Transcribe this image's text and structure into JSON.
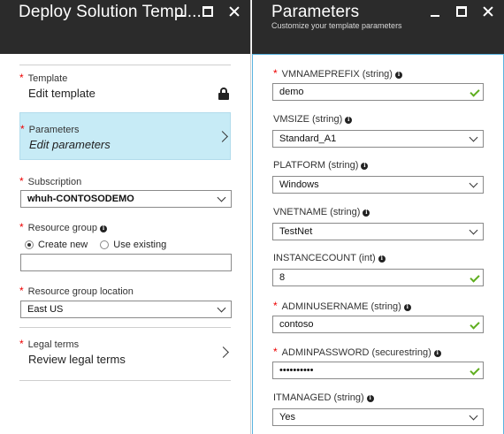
{
  "left_blade": {
    "title": "Deploy Solution Templ...",
    "template": {
      "title": "Template",
      "value": "Edit template"
    },
    "parameters": {
      "title": "Parameters",
      "value": "Edit parameters"
    },
    "subscription": {
      "label": "Subscription",
      "value": "whuh-CONTOSODEMO"
    },
    "resource_group": {
      "label": "Resource group",
      "options": [
        "Create new",
        "Use existing"
      ],
      "selected": "Create new",
      "value": ""
    },
    "location": {
      "label": "Resource group location",
      "value": "East US"
    },
    "legal": {
      "title": "Legal terms",
      "value": "Review legal terms"
    }
  },
  "right_blade": {
    "title": "Parameters",
    "subtitle": "Customize your template parameters",
    "params": [
      {
        "label": "VMNAMEPREFIX (string)",
        "value": "demo",
        "required": true,
        "control": "text-valid"
      },
      {
        "label": "VMSIZE (string)",
        "value": "Standard_A1",
        "required": false,
        "control": "dropdown"
      },
      {
        "label": "PLATFORM (string)",
        "value": "Windows",
        "required": false,
        "control": "dropdown"
      },
      {
        "label": "VNETNAME (string)",
        "value": "TestNet",
        "required": false,
        "control": "dropdown"
      },
      {
        "label": "INSTANCECOUNT (int)",
        "value": "8",
        "required": false,
        "control": "text-valid"
      },
      {
        "label": "ADMINUSERNAME (string)",
        "value": "contoso",
        "required": true,
        "control": "text-valid"
      },
      {
        "label": "ADMINPASSWORD (securestring)",
        "value": "••••••••••",
        "required": true,
        "control": "text-valid"
      },
      {
        "label": "ITMANAGED (string)",
        "value": "Yes",
        "required": false,
        "control": "dropdown"
      }
    ]
  },
  "colors": {
    "header_bg": "#2b2b2b",
    "selected_bg": "#c7ebf6",
    "required_star": "#e00000",
    "valid_check": "#5fae1f",
    "panel_border": "#5ab4e0"
  }
}
